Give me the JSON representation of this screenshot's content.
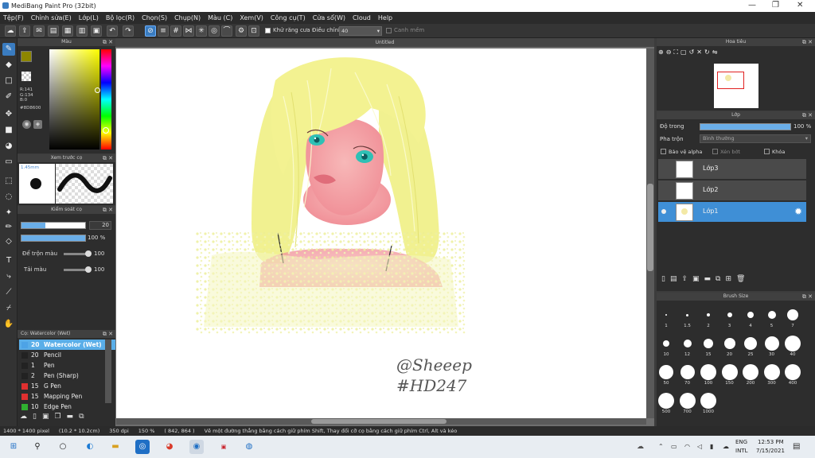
{
  "window": {
    "title": "MediBang Paint Pro (32bit)",
    "min": "—",
    "max": "❐",
    "close": "✕"
  },
  "menu": [
    "Tệp(F)",
    "Chỉnh sửa(E)",
    "Lớp(L)",
    "Bộ lọc(R)",
    "Chọn(S)",
    "Chụp(N)",
    "Màu (C)",
    "Xem(V)",
    "Công cụ(T)",
    "Cửa sổ(W)",
    "Cloud",
    "Help"
  ],
  "toolbar": {
    "antialias": "Khử răng cưa",
    "adjust_label": "Điều chỉnh",
    "adjust_value": "40",
    "smooth": "Canh mềm"
  },
  "color_panel": {
    "title": "Màu",
    "r": "R:141",
    "g": "G:134",
    "b": "B:0",
    "hex": "#8D8600",
    "fg_color": "#8D8600",
    "bg_color": "#ffffff"
  },
  "brush_preview": {
    "title": "Xem trước cọ",
    "size": "1.45mm"
  },
  "brush_control": {
    "title": "Kiểm soát cọ",
    "size_value": "20",
    "opacity_value": "100 %",
    "blend_label": "Để trộn màu",
    "blend_value": "100",
    "load_label": "Tải màu",
    "load_value": "100"
  },
  "brush_list": {
    "title": "Cọ: Watercolor (Wet)",
    "items": [
      {
        "size": "20",
        "name": "Watercolor (Wet)",
        "color": "#4da3e6",
        "selected": true
      },
      {
        "size": "20",
        "name": "Pencil",
        "color": "#222222"
      },
      {
        "size": "1",
        "name": "Pen",
        "color": "#222222"
      },
      {
        "size": "2",
        "name": "Pen (Sharp)",
        "color": "#222222"
      },
      {
        "size": "15",
        "name": "G Pen",
        "color": "#e03030"
      },
      {
        "size": "15",
        "name": "Mapping Pen",
        "color": "#e03030"
      },
      {
        "size": "10",
        "name": "Edge Pen",
        "color": "#30b030"
      }
    ]
  },
  "document": {
    "tab": "Untitled",
    "signature_line1": "@Sheeep",
    "signature_line2": "#HD247"
  },
  "navigator": {
    "title": "Hoa tiêu"
  },
  "layer_panel": {
    "title": "Lớp",
    "opacity_label": "Độ trong",
    "opacity_value": "100 %",
    "blend_label": "Pha trộn",
    "blend_value": "Bình thường",
    "protect_alpha": "Bảo vệ alpha",
    "clipping": "Xén bớt",
    "lock": "Khóa",
    "layers": [
      {
        "name": "Lớp3",
        "selected": false,
        "visible": false
      },
      {
        "name": "Lớp2",
        "selected": false,
        "visible": false
      },
      {
        "name": "Lớp1",
        "selected": true,
        "visible": true
      }
    ]
  },
  "brush_size_panel": {
    "title": "Brush Size",
    "sizes": [
      "1",
      "1.5",
      "2",
      "3",
      "4",
      "5",
      "7",
      "10",
      "12",
      "15",
      "20",
      "25",
      "30",
      "40",
      "50",
      "70",
      "100",
      "150",
      "200",
      "300",
      "400",
      "500",
      "700",
      "1000"
    ]
  },
  "status": {
    "dimensions": "1400 * 1400 pixel",
    "physical": "(10.2 * 10.2cm)",
    "dpi": "350 dpi",
    "zoom": "150 %",
    "coords": "( 842, 864 )",
    "hint": "Vẽ một đường thẳng bằng cách giữ phím Shift, Thay đổi cỡ cọ bằng cách giữ phím Ctrl, Alt và kéo"
  },
  "taskbar": {
    "lang1": "ENG",
    "lang2": "INTL",
    "time": "12:53 PM",
    "date": "7/15/2021"
  }
}
